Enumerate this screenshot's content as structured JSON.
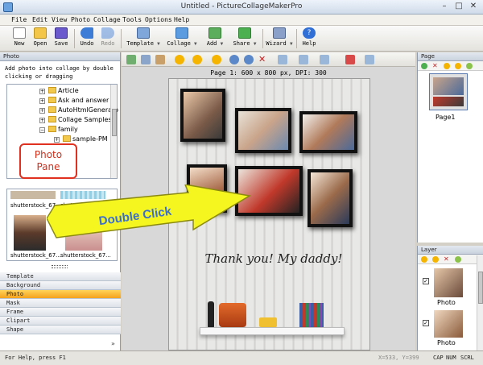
{
  "window": {
    "title": "Untitled - PictureCollageMakerPro"
  },
  "menu": [
    "File",
    "Edit",
    "View",
    "Photo",
    "Collage",
    "Tools",
    "Options",
    "Help"
  ],
  "toolbar": [
    {
      "label": "New",
      "icon": "new-file-icon"
    },
    {
      "label": "Open",
      "icon": "open-folder-icon"
    },
    {
      "label": "Save",
      "icon": "save-disk-icon"
    },
    {
      "label": "Undo",
      "icon": "undo-arrow-icon"
    },
    {
      "label": "Redo",
      "icon": "redo-arrow-icon"
    },
    {
      "label": "Template",
      "icon": "template-icon"
    },
    {
      "label": "Collage",
      "icon": "collage-icon"
    },
    {
      "label": "Add",
      "icon": "add-image-icon"
    },
    {
      "label": "Share",
      "icon": "share-icon"
    },
    {
      "label": "Wizard",
      "icon": "wizard-icon"
    },
    {
      "label": "Help",
      "icon": "help-icon"
    }
  ],
  "photo_pane": {
    "header": "Photo",
    "hint": "Add photo into collage by double clicking or dragging",
    "tree": [
      "Article",
      "Ask and answer",
      "AutoHtmlGenerato",
      "Collage Samples",
      "family",
      "sample-PM"
    ],
    "thumbnails": [
      "shutterstock_67...",
      "shutterstock_67...",
      "shutterstock_67...",
      "shutterstock_67..."
    ]
  },
  "callout": {
    "line1": "Photo",
    "line2": "Pane"
  },
  "arrow_label": "Double Click",
  "categories": [
    "Template",
    "Background",
    "Photo",
    "Mask",
    "Frame",
    "Clipart",
    "Shape"
  ],
  "active_category": "Photo",
  "canvas": {
    "page_info": "Page 1: 600 x 800 px, DPI: 300",
    "caption": "Thank you! My daddy!"
  },
  "page_panel": {
    "header": "Page",
    "page_label": "Page1"
  },
  "layer_panel": {
    "header": "Layer",
    "items": [
      "Photo",
      "Photo"
    ]
  },
  "status": {
    "help": "For Help, press F1",
    "coords": "X=533, Y=399",
    "flags": [
      "CAP",
      "NUM",
      "SCRL"
    ]
  },
  "colors": {
    "accent": "#f4a21c",
    "callout": "#e03020",
    "arrow_fill": "#f5f520",
    "arrow_text": "#3a6fd0"
  }
}
